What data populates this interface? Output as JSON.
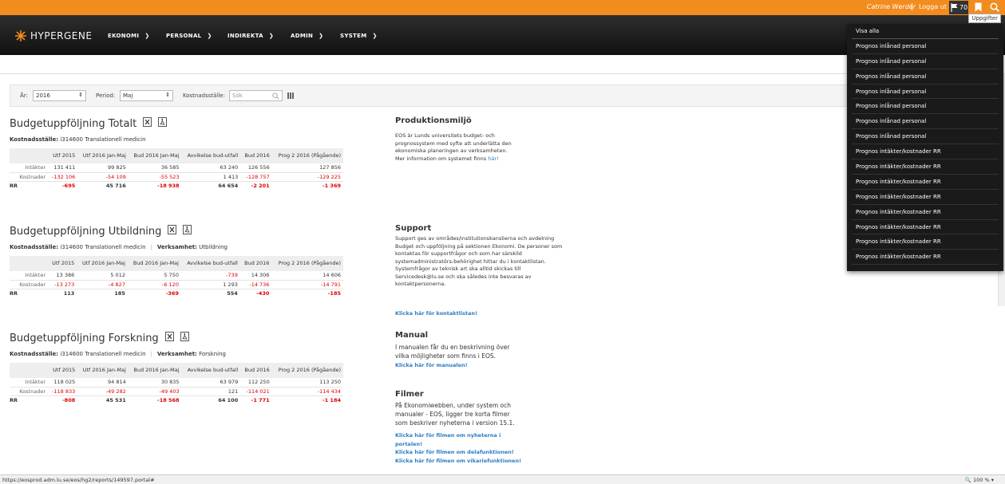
{
  "topbar": {
    "user": "Catrine Werder",
    "logout": "Logga ut",
    "task_count": "70",
    "tooltip": "Uppgifter"
  },
  "nav": {
    "logo": "HYPERGENE",
    "items": [
      "EKONOMI",
      "PERSONAL",
      "INDIREKTA",
      "ADMIN",
      "SYSTEM"
    ]
  },
  "filters": {
    "year_label": "År:",
    "year_value": "2016",
    "period_label": "Period:",
    "period_value": "Maj",
    "cost_label": "Kostnadsställe:",
    "search_placeholder": "Sök"
  },
  "columns": [
    "Utf 2015",
    "Utf 2016 Jan-Maj",
    "Bud 2016 Jan-Maj",
    "Avvikelse bud-utfall",
    "Bud 2016",
    "Prog 2 2016 (Pågående)"
  ],
  "sections": [
    {
      "title": "Budgetuppföljning Totalt",
      "meta_label": "Kostnadsställe:",
      "meta_value": "i314600 Translationell medicin",
      "activity_label": "",
      "activity_value": "",
      "rows": [
        {
          "label": "Intäkter",
          "values": [
            "131 411",
            "99 825",
            "36 585",
            "63 240",
            "126 556",
            "127 856"
          ]
        },
        {
          "label": "Kostnader",
          "values": [
            "-132 106",
            "-54 109",
            "-55 523",
            "1 413",
            "-128 757",
            "-129 225"
          ]
        },
        {
          "label": "RR",
          "values": [
            "-695",
            "45 716",
            "-18 938",
            "64 654",
            "-2 201",
            "-1 369"
          ]
        }
      ]
    },
    {
      "title": "Budgetuppföljning Utbildning",
      "meta_label": "Kostnadsställe:",
      "meta_value": "i314600 Translationell medicin",
      "activity_label": "Verksamhet:",
      "activity_value": "Utbildning",
      "rows": [
        {
          "label": "Intäkter",
          "values": [
            "13 386",
            "5 012",
            "5 750",
            "-739",
            "14 306",
            "14 606"
          ]
        },
        {
          "label": "Kostnader",
          "values": [
            "-13 273",
            "-4 827",
            "-6 120",
            "1 293",
            "-14 736",
            "-14 791"
          ]
        },
        {
          "label": "RR",
          "values": [
            "113",
            "185",
            "-369",
            "554",
            "-430",
            "-185"
          ]
        }
      ]
    },
    {
      "title": "Budgetuppföljning Forskning",
      "meta_label": "Kostnadsställe:",
      "meta_value": "i314600 Translationell medicin",
      "activity_label": "Verksamhet:",
      "activity_value": "Forskning",
      "rows": [
        {
          "label": "Intäkter",
          "values": [
            "118 025",
            "94 814",
            "30 835",
            "63 979",
            "112 250",
            "113 250"
          ]
        },
        {
          "label": "Kostnader",
          "values": [
            "-118 833",
            "-49 282",
            "-49 403",
            "121",
            "-114 021",
            "-114 434"
          ]
        },
        {
          "label": "RR",
          "values": [
            "-808",
            "45 531",
            "-18 568",
            "64 100",
            "-1 771",
            "-1 184"
          ]
        }
      ]
    }
  ],
  "info": {
    "prod_title": "Produktionsmiljö",
    "prod_lines": [
      "EOS är Lunds universitets budget- och",
      "prognossystem med syfte att underlätta den",
      "ekonomiska planeringen av verksamheten."
    ],
    "prod_more": "Mer information om systemet finns",
    "prod_link": "här!",
    "support_title": "Support",
    "support_lines": [
      "Support ges av områdes/institutionskanslierna och avdelning",
      "Budget och uppföljning på sektionen Ekonomi. De personer som",
      "kontaktas för supportfrågor och som har särskild",
      "systemadministratörs-behörighet hittar du i kontaktlistan.",
      "Systemfrågor av teknisk art ska alltid skickas till",
      "Servicedesk@lu.se och ska således inte besvaras av",
      "kontaktpersonerna."
    ],
    "support_link": "Klicka här för kontaktlistan!",
    "manual_title": "Manual",
    "manual_lines": [
      "I manualen får du en beskrivning över",
      "vilka möjligheter som finns i EOS."
    ],
    "manual_link": "Klicka här för manualen!",
    "film_title": "Filmer",
    "film_lines": [
      "På Ekonomiwebben, under system och",
      "manualer - EOS, ligger tre korta filmer",
      "som beskriver nyheterna i version 15.1."
    ],
    "film_links": [
      "Klicka här för filmen om nyheterna i",
      "portalen!",
      "Klicka här för filmen om delafunktionen!",
      "Klicka här för filmen om vikariefunktionen!"
    ]
  },
  "dropdown": {
    "items": [
      "Visa alla",
      "Prognos inlånad personal",
      "Prognos inlånad personal",
      "Prognos inlånad personal",
      "Prognos inlånad personal",
      "Prognos inlånad personal",
      "Prognos inlånad personal",
      "Prognos inlånad personal",
      "Prognos intäkter/kostnader RR",
      "Prognos intäkter/kostnader RR",
      "Prognos intäkter/kostnader RR",
      "Prognos intäkter/kostnader RR",
      "Prognos intäkter/kostnader RR",
      "Prognos intäkter/kostnader RR",
      "Prognos intäkter/kostnader RR",
      "Prognos intäkter/kostnader RR"
    ]
  },
  "status": {
    "url": "https://eosprod.adm.lu.se/eos/hg2/reports/149597.portal#",
    "zoom": "100 %"
  }
}
